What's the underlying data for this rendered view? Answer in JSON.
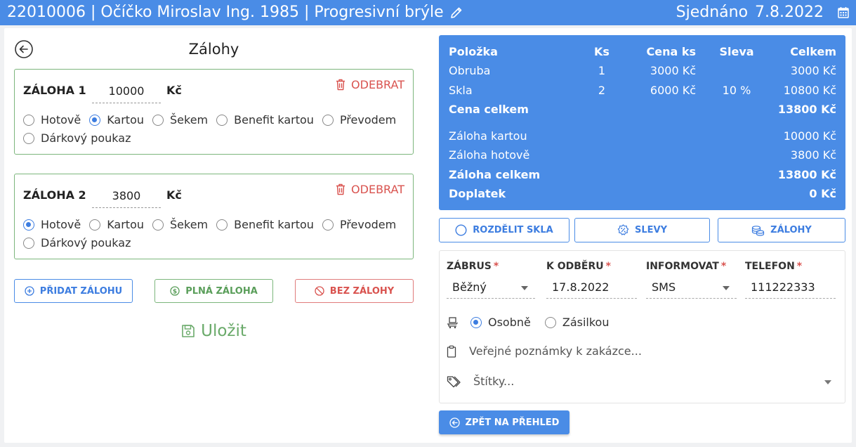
{
  "header": {
    "title": "22010006 | Očíčko Miroslav Ing. 1985 | Progresivní brýle",
    "status_label": "Sjednáno",
    "date": "7.8.2022"
  },
  "section": {
    "title": "Zálohy"
  },
  "deposits": [
    {
      "label": "ZÁLOHA 1",
      "amount": "10000",
      "currency": "Kč",
      "remove_label": "ODEBRAT",
      "methods": [
        "Hotově",
        "Kartou",
        "Šekem",
        "Benefit kartou",
        "Převodem",
        "Dárkový poukaz"
      ],
      "selected": "Kartou"
    },
    {
      "label": "ZÁLOHA 2",
      "amount": "3800",
      "currency": "Kč",
      "remove_label": "ODEBRAT",
      "methods": [
        "Hotově",
        "Kartou",
        "Šekem",
        "Benefit kartou",
        "Převodem",
        "Dárkový poukaz"
      ],
      "selected": "Hotově"
    }
  ],
  "actions": {
    "add_deposit": "PŘIDAT ZÁLOHU",
    "full_deposit": "PLNÁ ZÁLOHA",
    "no_deposit": "BEZ ZÁLOHY",
    "save": "Uložit"
  },
  "summary": {
    "headers": [
      "Položka",
      "Ks",
      "Cena ks",
      "Sleva",
      "Celkem"
    ],
    "items": [
      {
        "name": "Obruba",
        "ks": "1",
        "cena": "3000 Kč",
        "sleva": "",
        "celkem": "3000 Kč"
      },
      {
        "name": "Skla",
        "ks": "2",
        "cena": "6000 Kč",
        "sleva": "10 %",
        "celkem": "10800 Kč"
      }
    ],
    "total_label": "Cena celkem",
    "total_value": "13800 Kč",
    "card_deposit_label": "Záloha kartou",
    "card_deposit_value": "10000 Kč",
    "cash_deposit_label": "Záloha hotově",
    "cash_deposit_value": "3800 Kč",
    "deposit_total_label": "Záloha celkem",
    "deposit_total_value": "13800 Kč",
    "remaining_label": "Doplatek",
    "remaining_value": "0 Kč",
    "background_color": "#4a8ce6"
  },
  "tools": {
    "split_lenses": "ROZDĚLIT SKLA",
    "discounts": "SLEVY",
    "deposits": "ZÁLOHY"
  },
  "form": {
    "zabrus": {
      "label": "ZÁBRUS",
      "value": "Běžný"
    },
    "pickup": {
      "label": "K ODBĚRU",
      "value": "17.8.2022"
    },
    "inform": {
      "label": "INFORMOVAT",
      "value": "SMS"
    },
    "phone": {
      "label": "TELEFON",
      "value": "111222333"
    },
    "required_mark": "*",
    "delivery_options": [
      "Osobně",
      "Zásilkou"
    ],
    "delivery_selected": "Osobně",
    "notes_placeholder": "Veřejné poznámky k zakázce...",
    "tags_placeholder": "Štítky..."
  },
  "footer": {
    "back_label": "ZPĚT NA PŘEHLED"
  },
  "colors": {
    "accent": "#4a8ce6",
    "success": "#6aaa6a",
    "danger": "#d9534f"
  }
}
